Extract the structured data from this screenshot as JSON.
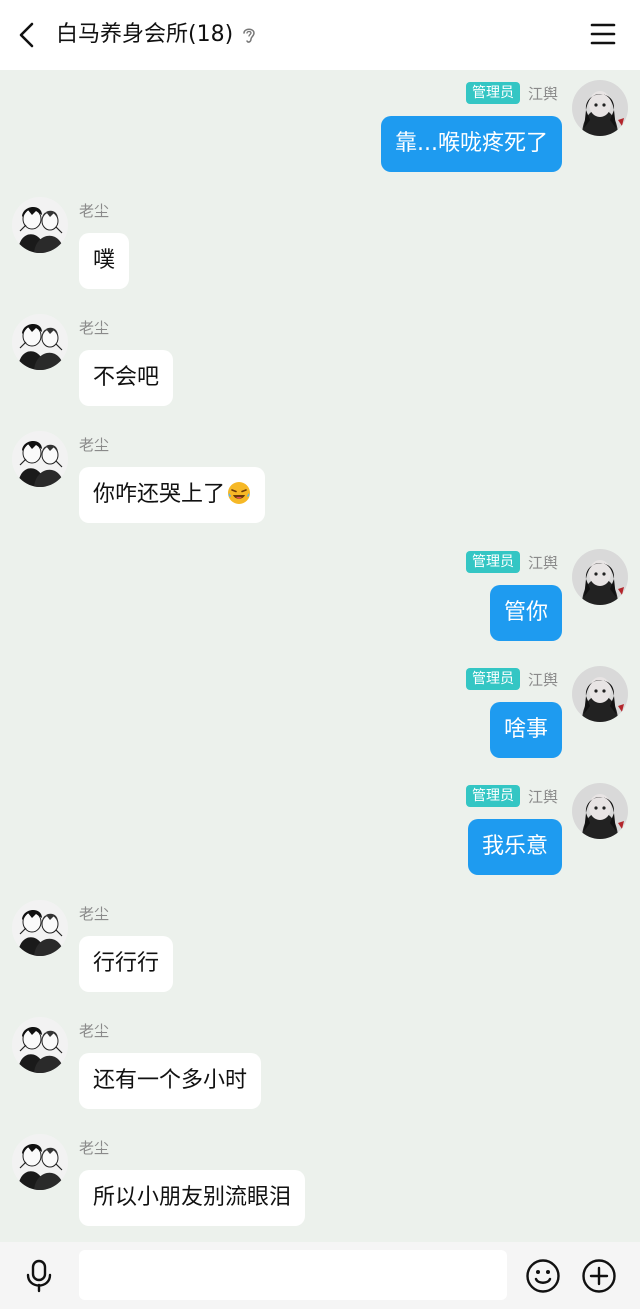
{
  "header": {
    "title": "白马养身会所(18)"
  },
  "messages": [
    {
      "side": "self",
      "badge": "管理员",
      "name": "江舆",
      "text": "靠...喉咙疼死了"
    },
    {
      "side": "other",
      "name": "老尘",
      "text": "噗"
    },
    {
      "side": "other",
      "name": "老尘",
      "text": "不会吧"
    },
    {
      "side": "other",
      "name": "老尘",
      "text": "你咋还哭上了",
      "emoji": "laughing-tears-emoji"
    },
    {
      "side": "self",
      "badge": "管理员",
      "name": "江舆",
      "text": "管你"
    },
    {
      "side": "self",
      "badge": "管理员",
      "name": "江舆",
      "text": "啥事"
    },
    {
      "side": "self",
      "badge": "管理员",
      "name": "江舆",
      "text": "我乐意"
    },
    {
      "side": "other",
      "name": "老尘",
      "text": "行行行"
    },
    {
      "side": "other",
      "name": "老尘",
      "text": "还有一个多小时"
    },
    {
      "side": "other",
      "name": "老尘",
      "text": "所以小朋友别流眼泪"
    }
  ],
  "input": {
    "placeholder": "",
    "value": ""
  },
  "colors": {
    "chat_background": "#ecf1ec",
    "self_bubble": "#1e9bf0",
    "other_bubble": "#ffffff",
    "admin_badge": "#34c6c4"
  }
}
